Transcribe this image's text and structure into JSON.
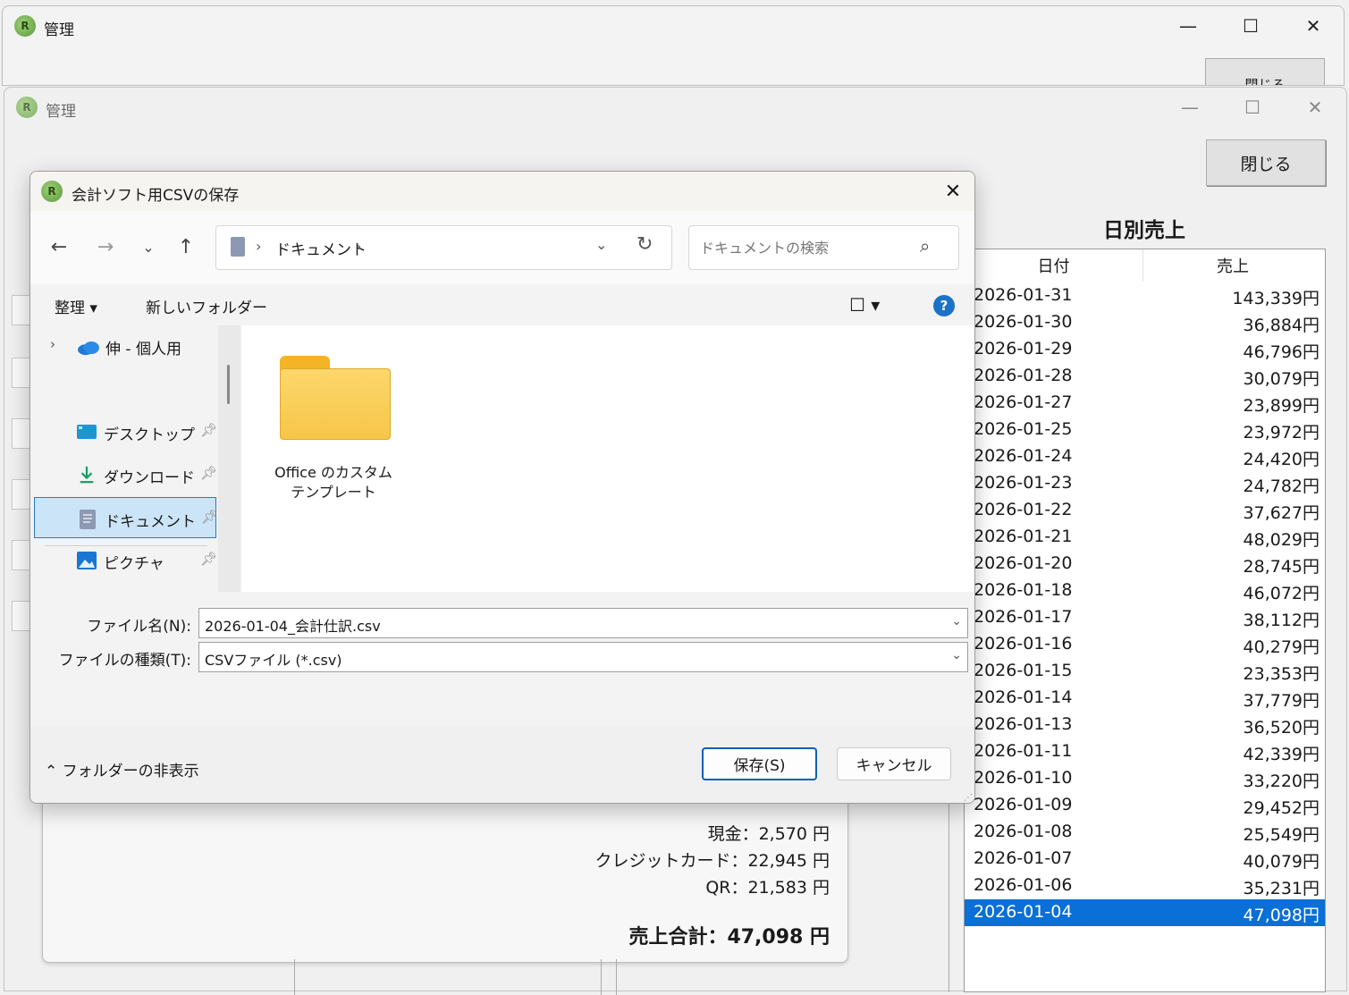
{
  "back_window_1": {
    "title": "管理",
    "close_button_partial": "閉じる"
  },
  "back_window_2": {
    "title": "管理",
    "close_button": "閉じる",
    "daily_sales": {
      "title": "日別売上",
      "columns": [
        "日付",
        "売上"
      ],
      "rows": [
        {
          "date": "2026-01-31",
          "sales": "143,339円"
        },
        {
          "date": "2026-01-30",
          "sales": "36,884円"
        },
        {
          "date": "2026-01-29",
          "sales": "46,796円"
        },
        {
          "date": "2026-01-28",
          "sales": "30,079円"
        },
        {
          "date": "2026-01-27",
          "sales": "23,899円"
        },
        {
          "date": "2026-01-25",
          "sales": "23,972円"
        },
        {
          "date": "2026-01-24",
          "sales": "24,420円"
        },
        {
          "date": "2026-01-23",
          "sales": "24,782円"
        },
        {
          "date": "2026-01-22",
          "sales": "37,627円"
        },
        {
          "date": "2026-01-21",
          "sales": "48,029円"
        },
        {
          "date": "2026-01-20",
          "sales": "28,745円"
        },
        {
          "date": "2026-01-18",
          "sales": "46,072円"
        },
        {
          "date": "2026-01-17",
          "sales": "38,112円"
        },
        {
          "date": "2026-01-16",
          "sales": "40,279円"
        },
        {
          "date": "2026-01-15",
          "sales": "23,353円"
        },
        {
          "date": "2026-01-14",
          "sales": "37,779円"
        },
        {
          "date": "2026-01-13",
          "sales": "36,520円"
        },
        {
          "date": "2026-01-11",
          "sales": "42,339円"
        },
        {
          "date": "2026-01-10",
          "sales": "33,220円"
        },
        {
          "date": "2026-01-09",
          "sales": "29,452円"
        },
        {
          "date": "2026-01-08",
          "sales": "25,549円"
        },
        {
          "date": "2026-01-07",
          "sales": "40,079円"
        },
        {
          "date": "2026-01-06",
          "sales": "35,231円"
        },
        {
          "date": "2026-01-04",
          "sales": "47,098円",
          "selected": true
        }
      ]
    },
    "summary": {
      "cash": "現金：2,570 円",
      "credit": "クレジットカード：22,945 円",
      "qr": "QR：21,583 円",
      "total": "売上合計：47,098 円"
    }
  },
  "dialog": {
    "title": "会計ソフト用CSVの保存",
    "address": {
      "current": "ドキュメント",
      "sep": "›"
    },
    "search": {
      "placeholder": "ドキュメントの検索"
    },
    "toolbar": {
      "organize": "整理 ▾",
      "new_folder": "新しいフォルダー"
    },
    "nav_items": [
      {
        "label": "伸 - 個人用"
      },
      {
        "label": "デスクトップ"
      },
      {
        "label": "ダウンロード"
      },
      {
        "label": "ドキュメント",
        "selected": true
      },
      {
        "label": "ピクチャ"
      }
    ],
    "folders": [
      {
        "label": "Office のカスタム テンプレート"
      }
    ],
    "filename_label": "ファイル名(N):",
    "filename_value": "2026-01-04_会計仕訳.csv",
    "filetype_label": "ファイルの種類(T):",
    "filetype_value": "CSVファイル (*.csv)",
    "hide_folders": "フォルダーの非表示",
    "save_button": "保存(S)",
    "cancel_button": "キャンセル"
  },
  "colors": {
    "selection_blue": "#0a6fd6",
    "primary_border": "#0d5fb5",
    "folder_yellow": "#f7c648"
  }
}
